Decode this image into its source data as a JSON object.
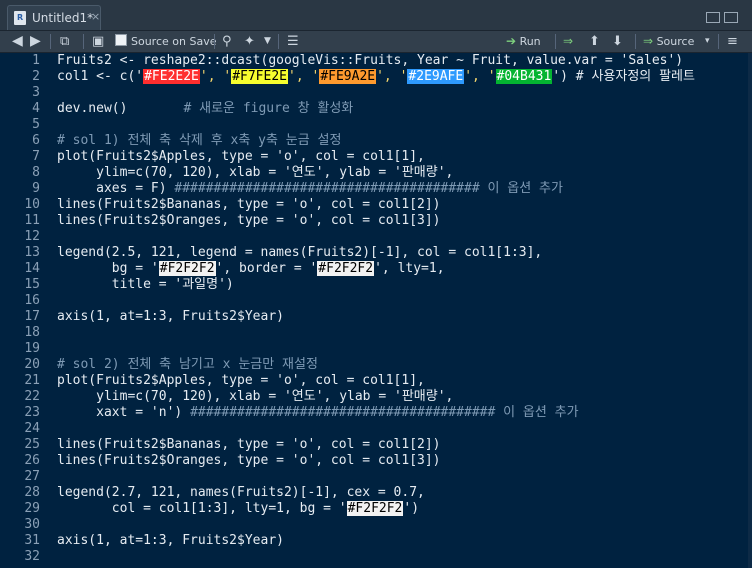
{
  "tab": {
    "title": "Untitled1*",
    "close": "×"
  },
  "toolbar": {
    "source_on_save": "Source on Save",
    "run": "Run",
    "source": "Source",
    "source_arrow": "▾"
  },
  "colors": {
    "swatch1": "#FE2E2E",
    "swatch2": "#F7FE2E",
    "swatch3": "#FE9A2E",
    "swatch4": "#2E9AFE",
    "swatch5": "#04B431",
    "swatch_bg": "#F2F2F2"
  },
  "code": {
    "l1": "Fruits2 <- reshape2::dcast(googleVis::Fruits, Year ~ Fruit, value.var = 'Sales')",
    "l2a": "col1 <- c('",
    "l2_c1": "#FE2E2E",
    "l2b": "', '",
    "l2_c2": "#F7FE2E",
    "l2c": "', '",
    "l2_c3": "#FE9A2E",
    "l2d": "', '",
    "l2_c4": "#2E9AFE",
    "l2e": "', '",
    "l2_c5": "#04B431",
    "l2f": "') # 사용자정의 팔레트",
    "l4a": "dev.new()",
    "l4b": "# 새로운 figure 창 활성화",
    "l6": "# sol 1) 전체 축 삭제 후 x축 y축 눈금 설정",
    "l7": "plot(Fruits2$Apples, type = 'o', col = col1[1],",
    "l8": "     ylim=c(70, 120), xlab = '연도', ylab = '판매량',",
    "l9a": "     axes = F) ",
    "l9b": "####################################### 이 옵션 추가",
    "l10": "lines(Fruits2$Bananas, type = 'o', col = col1[2])",
    "l11": "lines(Fruits2$Oranges, type = 'o', col = col1[3])",
    "l13": "legend(2.5, 121, legend = names(Fruits2)[-1], col = col1[1:3],",
    "l14a": "       bg = '",
    "l14_c": "#F2F2F2",
    "l14b": "', border = '",
    "l14_c2": "#F2F2F2",
    "l14c": "', lty=1,",
    "l15": "       title = '과일명')",
    "l17": "axis(1, at=1:3, Fruits2$Year)",
    "l20": "# sol 2) 전체 축 남기고 x 눈금만 재설정",
    "l21": "plot(Fruits2$Apples, type = 'o', col = col1[1],",
    "l22": "     ylim=c(70, 120), xlab = '연도', ylab = '판매량',",
    "l23a": "     xaxt = 'n') ",
    "l23b": "####################################### 이 옵션 추가",
    "l25": "lines(Fruits2$Bananas, type = 'o', col = col1[2])",
    "l26": "lines(Fruits2$Oranges, type = 'o', col = col1[3])",
    "l28": "legend(2.7, 121, names(Fruits2)[-1], cex = 0.7,",
    "l29a": "       col = col1[1:3], lty=1, bg = '",
    "l29_c": "#F2F2F2",
    "l29b": "')",
    "l31": "axis(1, at=1:3, Fruits2$Year)"
  },
  "line_numbers": [
    "1",
    "2",
    "3",
    "4",
    "5",
    "6",
    "7",
    "8",
    "9",
    "10",
    "11",
    "12",
    "13",
    "14",
    "15",
    "16",
    "17",
    "18",
    "19",
    "20",
    "21",
    "22",
    "23",
    "24",
    "25",
    "26",
    "27",
    "28",
    "29",
    "30",
    "31",
    "32"
  ]
}
